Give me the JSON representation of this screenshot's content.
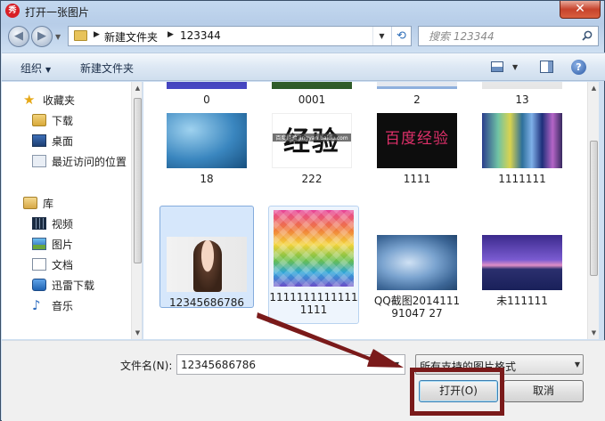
{
  "window": {
    "title": "打开一张图片",
    "app_icon_glyph": "秀",
    "close_glyph": "✕"
  },
  "address": {
    "crumbs": [
      "新建文件夹",
      "123344"
    ]
  },
  "search": {
    "placeholder": "搜索 123344"
  },
  "toolbar": {
    "organize_label": "组织",
    "new_folder_label": "新建文件夹",
    "help_glyph": "?"
  },
  "navpane": {
    "favorites_label": "收藏夹",
    "favorites": [
      "下载",
      "桌面",
      "最近访问的位置"
    ],
    "library_label": "库",
    "library": [
      "视频",
      "图片",
      "文档",
      "迅雷下载",
      "音乐"
    ]
  },
  "files": {
    "row0": [
      "0",
      "0001",
      "2",
      "13"
    ],
    "row1": [
      "18",
      "222",
      "1111",
      "1111111"
    ],
    "row2": [
      "12345686786",
      "11111111111111111",
      "QQ截图201411191047 27",
      "未111111"
    ],
    "thumb_texts": {
      "jingyan": "经验",
      "jingyan_small": "百度经验 jingyan.baidu.com",
      "baidu": "百度经验"
    }
  },
  "bottom": {
    "filename_label": "文件名(N):",
    "filename_value": "12345686786",
    "filter_value": "所有支持的图片格式",
    "open_label": "打开(O)",
    "cancel_label": "取消"
  },
  "colors": {
    "annotation": "#7a1a1a"
  }
}
